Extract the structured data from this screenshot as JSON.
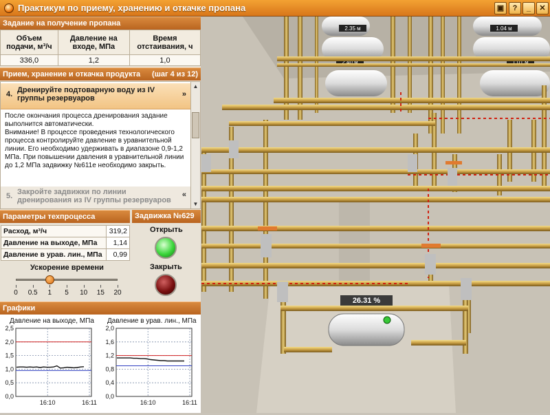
{
  "window": {
    "title": "Практикум по приему, хранению и откачке пропана",
    "controls": [
      "▣",
      "?",
      "_",
      "✕"
    ]
  },
  "task": {
    "header": "Задание на получение пропана",
    "columns": [
      "Объем подачи, м³/ч",
      "Давление на входе, МПа",
      "Время отстаивания, ч"
    ],
    "values": [
      "336,0",
      "1,2",
      "1,0"
    ]
  },
  "procedure": {
    "header": "Прием, хранение и откачка продукта",
    "step_counter": "(шаг 4 из 12)",
    "active_step": {
      "number": "4.",
      "title": "Дренируйте подтоварную воду из IV группы резервуаров",
      "chevron": "»"
    },
    "active_text": "После окончания процесса дренирования задание выполнится автоматически.\nВнимание! В процессе проведения технологического процесса контролируйте давление в уравнительной линии. Его необходимо удерживать в диапазоне 0,9-1,2 МПа. При повышении давления в уравнительной линии до 1,2 МПа задвижку №611е необходимо закрыть.",
    "next_step": {
      "number": "5.",
      "title": "Закройте задвижки по линии дренирования из IV группы резервуаров",
      "chevron": "«"
    }
  },
  "params": {
    "header": "Параметры техпроцесса",
    "rows": [
      {
        "label": "Расход, м³/ч",
        "value": "319,2"
      },
      {
        "label": "Давление на выходе, МПа",
        "value": "1,14"
      },
      {
        "label": "Давление в урав. лин., МПа",
        "value": "0,99"
      }
    ]
  },
  "acceleration": {
    "label": "Ускорение времени",
    "ticks": [
      "0",
      "0.5",
      "1",
      "5",
      "10",
      "15",
      "20"
    ],
    "selected_index": 2
  },
  "valve": {
    "header": "Задвижка №629",
    "open_label": "Открыть",
    "close_label": "Закрыть"
  },
  "graphs": {
    "header": "Графики",
    "charts": [
      {
        "title": "Давление на выходе, МПа",
        "yticks": [
          "2,5",
          "2,0",
          "1,5",
          "1,0",
          "0,5",
          "0,0"
        ],
        "xticks": [
          "16:10",
          "16:11"
        ]
      },
      {
        "title": "Давление в урав. лин., МПа",
        "yticks": [
          "2,0",
          "1,6",
          "1,2",
          "0,8",
          "0,4",
          "0,0"
        ],
        "xticks": [
          "16:10",
          "16:11"
        ]
      }
    ]
  },
  "chart_data": [
    {
      "type": "line",
      "title": "Давление на выходе, МПа",
      "ylim": [
        0,
        2.5
      ],
      "x": [
        "16:10",
        "16:11"
      ],
      "series": [
        {
          "values": [
            1.07,
            1.08,
            1.08,
            1.07,
            1.08,
            1.07,
            1.08,
            1.06,
            1.08,
            1.07,
            1.07,
            1.08,
            1.12,
            1.04,
            1.05,
            1.07,
            1.06,
            1.05,
            1.06,
            1.08,
            1.09
          ]
        }
      ],
      "limits": {
        "high": 2.0,
        "low": 0.95
      }
    },
    {
      "type": "line",
      "title": "Давление в урав. лин., МПа",
      "ylim": [
        0,
        2.0
      ],
      "x": [
        "16:10",
        "16:11"
      ],
      "series": [
        {
          "values": [
            1.13,
            1.13,
            1.13,
            1.13,
            1.13,
            1.12,
            1.12,
            1.11,
            1.11,
            1.1,
            1.08,
            1.07,
            1.06,
            1.05,
            1.05,
            1.04,
            1.04,
            1.04,
            1.04,
            1.04,
            1.04
          ]
        }
      ],
      "limits": {
        "high": 1.2,
        "low": 0.9
      }
    }
  ],
  "scene": {
    "tank_labels": [
      "2.35 м",
      "1.04 м",
      "2.40 м",
      "1.01 м"
    ],
    "level_readout": "26.31 %"
  }
}
